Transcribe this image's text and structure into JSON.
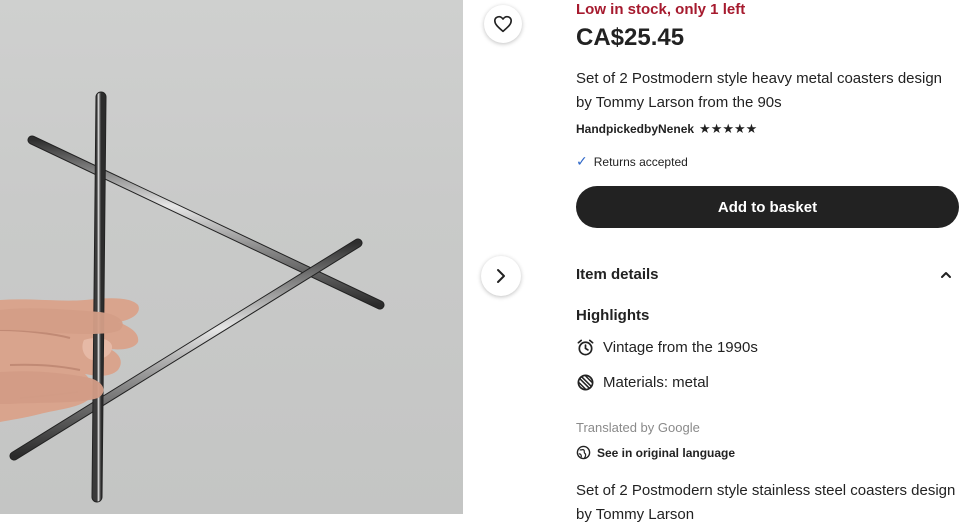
{
  "product": {
    "stock_status": "Low in stock, only 1 left",
    "price": "CA$25.45",
    "title": "Set of 2 Postmodern style heavy metal coasters design by Tommy Larson from the 90s",
    "shop_name": "HandpickedbyNenek",
    "rating_stars": "★★★★★",
    "rating_value": 5,
    "returns_text": "Returns accepted",
    "add_to_basket_label": "Add to basket"
  },
  "item_details": {
    "section_title": "Item details",
    "highlights_title": "Highlights",
    "highlights": [
      {
        "icon": "alarm-clock-icon",
        "text": "Vintage from the 1990s"
      },
      {
        "icon": "materials-icon",
        "text": "Materials: metal"
      }
    ],
    "translated_by": "Translated by Google",
    "see_original_label": "See in original language",
    "description": "Set of 2 Postmodern style stainless steel coasters design by Tommy Larson"
  },
  "colors": {
    "stock_red": "#a61a2e",
    "button_dark": "#222222",
    "check_blue": "#2e67c8"
  }
}
